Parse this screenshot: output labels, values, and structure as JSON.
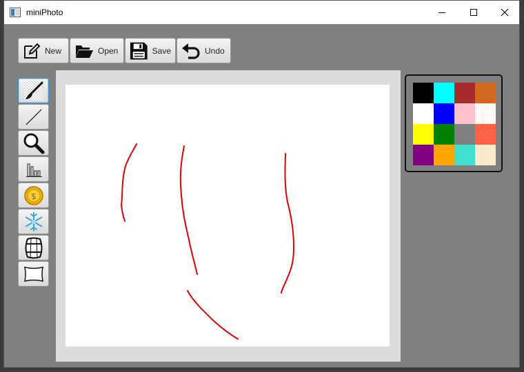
{
  "window": {
    "title": "miniPhoto"
  },
  "toolbar": {
    "new_label": "New",
    "open_label": "Open",
    "save_label": "Save",
    "undo_label": "Undo"
  },
  "tools": [
    {
      "name": "brush",
      "icon": "brush-icon",
      "active": true
    },
    {
      "name": "line",
      "icon": "line-icon"
    },
    {
      "name": "zoom",
      "icon": "magnifier-icon"
    },
    {
      "name": "histogram",
      "icon": "bar-chart-icon"
    },
    {
      "name": "coin",
      "icon": "coin-icon"
    },
    {
      "name": "snowflake",
      "icon": "snowflake-icon"
    },
    {
      "name": "barrel",
      "icon": "barrel-icon"
    },
    {
      "name": "frame",
      "icon": "frame-icon"
    }
  ],
  "palette": {
    "colors": [
      "#000000",
      "#00ffff",
      "#a52a2a",
      "#d2691e",
      "#ffffff",
      "#0000ff",
      "#ffc0cb",
      "#fffaf5",
      "#ffff00",
      "#008000",
      "#808080",
      "#ff6347",
      "#800080",
      "#ffa500",
      "#40e0d0",
      "#fdebd0"
    ]
  },
  "canvas": {
    "stroke_color": "#e00000"
  }
}
